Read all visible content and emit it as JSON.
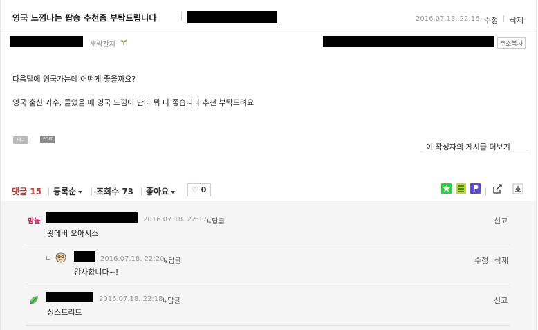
{
  "post": {
    "title": "영국 느낌나는 팝송 추천좀 부탁드립니다",
    "date": "2016.07.18. 22:16",
    "edit_label": "수정",
    "delete_label": "삭제",
    "author_grade": "새싹간지",
    "copy_address_label": "주소복사",
    "content": [
      "다음달에 영국가는데 어떤게 좋을까요?",
      "영국 출신 가수, 들었을 때 영국 느낌이 난다 뭐 다 좋습니다 추천 부탁드려요"
    ],
    "tag_label": "태그",
    "edit_badge": "EDIT",
    "more_posts_label": "이 작성자의 게시글 더보기"
  },
  "comment_bar": {
    "comments_label": "댓글",
    "comments_count": "15",
    "sort_label": "등록순",
    "views_label": "조회수",
    "views_count": "73",
    "likes_label": "좋아요",
    "like_count": "0",
    "heart_glyph": "♡"
  },
  "comments": [
    {
      "avatar": "맘놀",
      "date": "2016.07.18. 22:17",
      "reply_label": "답글",
      "text": "왓에버 오아시스",
      "report_label": "신고"
    },
    {
      "date": "2016.07.18. 22:20",
      "reply_label": "답글",
      "text": "감사합니다~!",
      "edit_label": "수정",
      "delete_label": "삭제"
    },
    {
      "date": "2016.07.18. 22:18",
      "reply_label": "답글",
      "text": "싱스트리트",
      "report_label": "신고"
    }
  ],
  "colors": {
    "accent_red": "#c0392b",
    "green_share": "#2ecc40",
    "yellow_share": "#c8d62e",
    "purple_share": "#5b4bd1"
  }
}
